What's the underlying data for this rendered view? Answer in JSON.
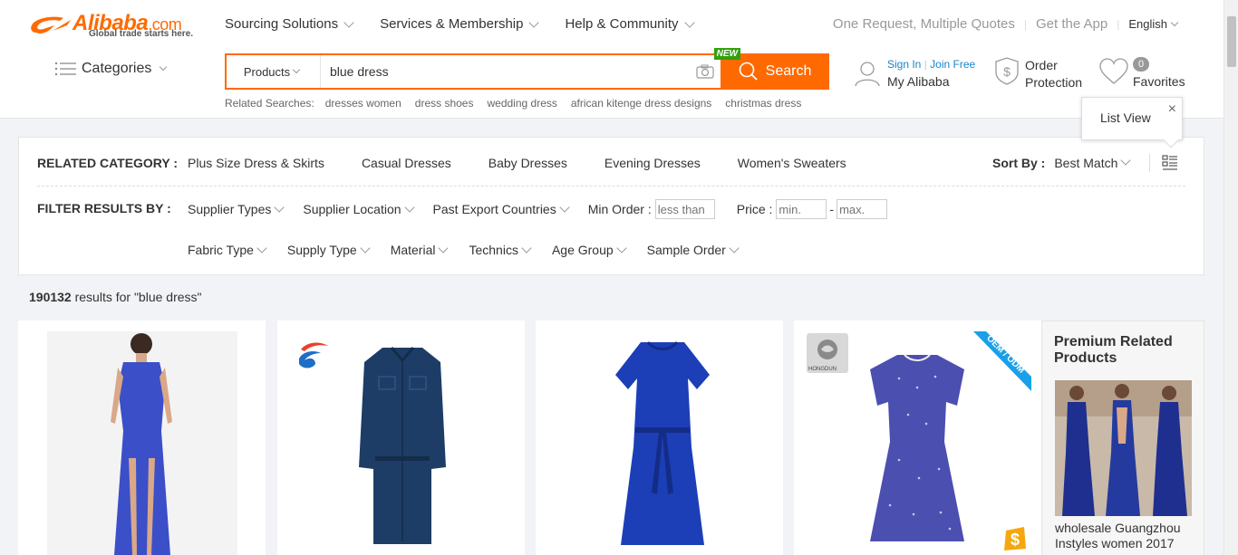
{
  "header": {
    "logo_text": "Alibaba",
    "logo_domain": ".com",
    "logo_tagline": "Global trade starts here.",
    "nav": [
      "Sourcing Solutions",
      "Services & Membership",
      "Help & Community"
    ],
    "links": [
      "One Request, Multiple Quotes",
      "Get the App"
    ],
    "language": "English",
    "categories_label": "Categories"
  },
  "search": {
    "type_label": "Products",
    "query": "blue dress",
    "button_label": "Search",
    "new_badge": "NEW",
    "related_label": "Related Searches:",
    "related": [
      "dresses women",
      "dress shoes",
      "wedding dress",
      "african kitenge dress designs",
      "christmas dress"
    ]
  },
  "account": {
    "sign_in": "Sign In",
    "join_free": "Join Free",
    "title": "My Alibaba"
  },
  "order_protection": {
    "line1": "Order",
    "line2": "Protection"
  },
  "favorites": {
    "count": "0",
    "label": "Favorites"
  },
  "tooltip": {
    "text": "List View",
    "close": "×"
  },
  "filters": {
    "related_category_label": "RELATED CATEGORY :",
    "related_categories": [
      "Plus Size Dress & Skirts",
      "Casual Dresses",
      "Baby Dresses",
      "Evening Dresses",
      "Women's Sweaters"
    ],
    "sort_label": "Sort By :",
    "sort_value": "Best Match",
    "filter_label": "FILTER RESULTS BY :",
    "row1": [
      "Supplier Types",
      "Supplier Location",
      "Past Export Countries"
    ],
    "min_order_label": "Min Order :",
    "min_order_placeholder": "less than",
    "price_label": "Price :",
    "price_min_placeholder": "min.",
    "price_dash": "-",
    "price_max_placeholder": "max.",
    "row2": [
      "Fabric Type",
      "Supply Type",
      "Material",
      "Technics",
      "Age Group",
      "Sample Order"
    ]
  },
  "results": {
    "count": "190132",
    "text": " results for \"blue dress\""
  },
  "premium": {
    "title": "Premium Related Products",
    "description": "wholesale Guangzhou Instyles women 2017"
  },
  "products": {
    "badge_oem": "OEM / ODM",
    "badge_brand": "HONGDUN"
  },
  "colors": {
    "accent": "#ff6a00",
    "link": "#1686cc",
    "new_badge": "#32a00d"
  }
}
